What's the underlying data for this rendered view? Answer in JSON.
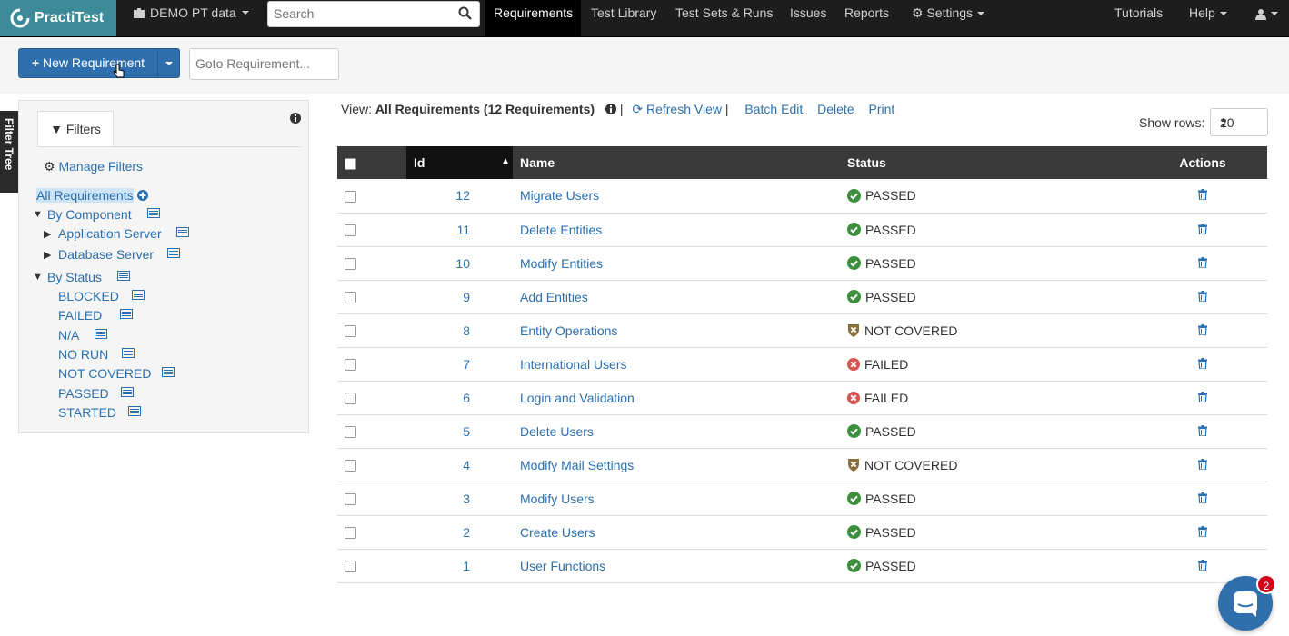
{
  "app": {
    "logo_text": "PractiTest",
    "project": "DEMO PT data"
  },
  "search": {
    "placeholder": "Search"
  },
  "nav": {
    "requirements": "Requirements",
    "test_library": "Test Library",
    "test_sets_runs": "Test Sets & Runs",
    "issues": "Issues",
    "reports": "Reports",
    "settings": "Settings",
    "tutorials": "Tutorials",
    "help": "Help"
  },
  "toolbar": {
    "new_requirement": "New Requirement",
    "goto_placeholder": "Goto Requirement..."
  },
  "filter_tree_tab": "Filter Tree",
  "filters": {
    "tab_label": "Filters",
    "manage": "Manage Filters",
    "all": "All Requirements",
    "by_component": "By Component",
    "components": [
      "Application Server",
      "Database Server"
    ],
    "by_status": "By Status",
    "statuses": [
      "BLOCKED",
      "FAILED",
      "N/A",
      "NO RUN",
      "NOT COVERED",
      "PASSED",
      "STARTED"
    ]
  },
  "view": {
    "label": "View:",
    "name": "All Requirements (12 Requirements)",
    "refresh": "Refresh View",
    "batch_edit": "Batch Edit",
    "delete": "Delete",
    "print": "Print",
    "show_rows_label": "Show rows:",
    "show_rows_value": "20"
  },
  "table": {
    "headers": {
      "id": "Id",
      "name": "Name",
      "status": "Status",
      "actions": "Actions"
    },
    "rows": [
      {
        "id": "12",
        "name": "Migrate Users",
        "status": "PASSED"
      },
      {
        "id": "11",
        "name": "Delete Entities",
        "status": "PASSED"
      },
      {
        "id": "10",
        "name": "Modify Entities",
        "status": "PASSED"
      },
      {
        "id": "9",
        "name": "Add Entities",
        "status": "PASSED"
      },
      {
        "id": "8",
        "name": "Entity Operations",
        "status": "NOT COVERED"
      },
      {
        "id": "7",
        "name": "International Users",
        "status": "FAILED"
      },
      {
        "id": "6",
        "name": "Login and Validation",
        "status": "FAILED"
      },
      {
        "id": "5",
        "name": "Delete Users",
        "status": "PASSED"
      },
      {
        "id": "4",
        "name": "Modify Mail Settings",
        "status": "NOT COVERED"
      },
      {
        "id": "3",
        "name": "Modify Users",
        "status": "PASSED"
      },
      {
        "id": "2",
        "name": "Create Users",
        "status": "PASSED"
      },
      {
        "id": "1",
        "name": "User Functions",
        "status": "PASSED"
      }
    ]
  },
  "chat": {
    "badge": "2"
  },
  "colors": {
    "passed": "#3c8f3c",
    "failed": "#d9534f",
    "not_covered": "#8b6d3a",
    "link": "#2a6fb0",
    "brand": "#3d8a98"
  }
}
